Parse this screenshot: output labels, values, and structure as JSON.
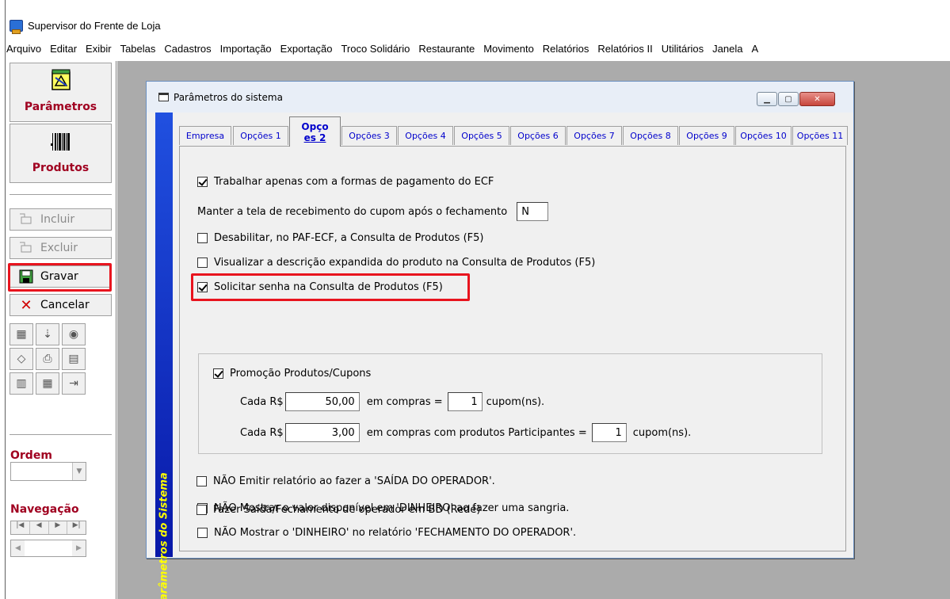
{
  "app": {
    "title": "Supervisor do Frente de Loja"
  },
  "menu": [
    "Arquivo",
    "Editar",
    "Exibir",
    "Tabelas",
    "Cadastros",
    "Importação",
    "Exportação",
    "Troco Solidário",
    "Restaurante",
    "Movimento",
    "Relatórios",
    "Relatórios II",
    "Utilitários",
    "Janela",
    "A"
  ],
  "left_panel": {
    "parametros_label": "Parâmetros",
    "produtos_label": "Produtos",
    "incluir_label": "Incluir",
    "excluir_label": "Excluir",
    "gravar_label": "Gravar",
    "cancelar_label": "Cancelar",
    "ordem_label": "Ordem",
    "navegacao_label": "Navegação"
  },
  "dialog": {
    "title": "Parâmetros do sistema",
    "sidebar_text": "Parâmetros do Sistema",
    "tabs": [
      {
        "label": "Empresa"
      },
      {
        "label": "Opções 1"
      },
      {
        "label": "Opço",
        "label2": "es 2"
      },
      {
        "label": "Opções 3"
      },
      {
        "label": "Opções 4"
      },
      {
        "label": "Opções 5"
      },
      {
        "label": "Opções 6"
      },
      {
        "label": "Opções 7"
      },
      {
        "label": "Opções 8"
      },
      {
        "label": "Opções 9"
      },
      {
        "label": "Opções 10"
      },
      {
        "label": "Opções 11"
      }
    ],
    "options": {
      "trabalhar": "Trabalhar apenas com a formas de pagamento do ECF",
      "manter": "Manter a tela de recebimento do cupom após o fechamento",
      "manter_value": "N",
      "desabilitar": "Desabilitar, no PAF-ECF, a Consulta de Produtos (F5)",
      "visualizar": "Visualizar a descrição expandida do produto na Consulta de Produtos (F5)",
      "solicitar": "Solicitar senha na Consulta de Produtos (F5)",
      "promocao": "Promoção Produtos/Cupons",
      "cada1": "Cada R$",
      "valor1": "50,00",
      "compras1": "em compras =",
      "qtd1": "1",
      "cupom1": "cupom(ns).",
      "cada2": "Cada R$",
      "valor2": "3,00",
      "compras2": "em compras com produtos Participantes =",
      "qtd2": "1",
      "cupom2": "cupom(ns).",
      "nao_dinheiro": "NÃO Mostrar o valor disponível em 'DINHEIRO' ao fazer uma sangria.",
      "nao_relatorio": "NÃO Mostrar o 'DINHEIRO' no relatório 'FECHAMENTO DO OPERADOR'.",
      "nao_emitir": "NÃO Emitir relatório ao fazer a 'SAÍDA DO OPERADOR'.",
      "fazer_saida": "Fazer Saída/Fechamento de operador em BD (Rede)"
    }
  },
  "colors": {
    "highlight": "#e8141e",
    "brand_label": "#a00020",
    "sidebar_text": "#ffff00"
  }
}
